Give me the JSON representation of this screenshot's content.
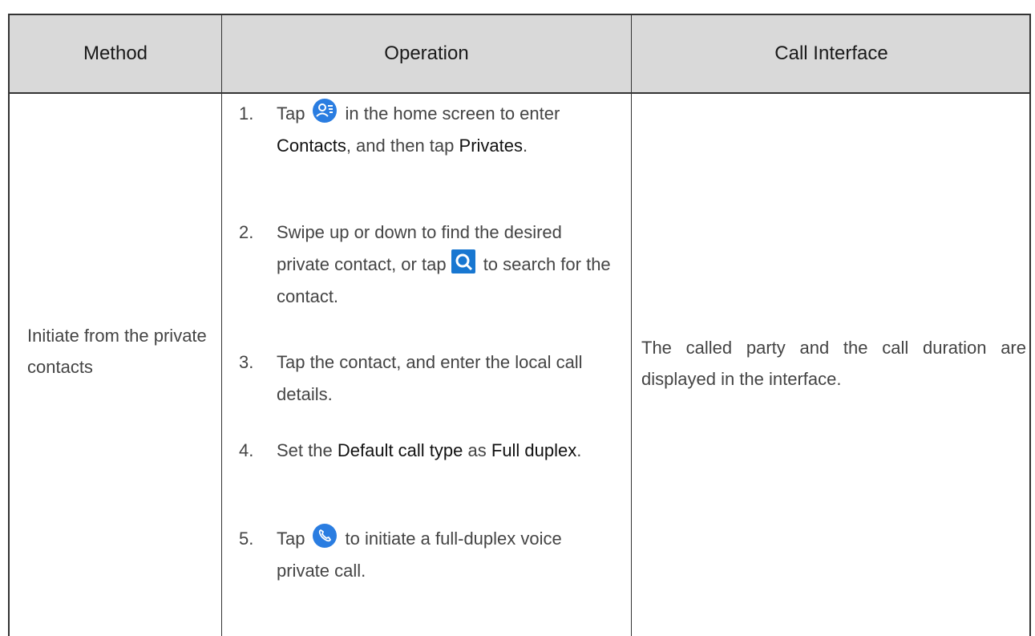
{
  "header": {
    "method": "Method",
    "operation": "Operation",
    "call_interface": "Call Interface"
  },
  "row": {
    "method": "Initiate from the private contacts",
    "call_interface": "The called party and the call duration are displayed in the interface.",
    "steps": [
      {
        "num": "1.",
        "a": "Tap",
        "b": "in the home screen to enter",
        "c": "Contacts",
        "d": ", and then tap",
        "e": "Privates",
        "f": "."
      },
      {
        "num": "2.",
        "a": "Swipe up or down to find the desired private contact, or tap",
        "b": "to search for the contact."
      },
      {
        "num": "3.",
        "a": "Tap the contact, and enter the local call details."
      },
      {
        "num": "4.",
        "a": "Set the",
        "b": "Default call type",
        "c": "as",
        "d": "Full duplex",
        "e": "."
      },
      {
        "num": "5.",
        "a": "Tap",
        "b": "to initiate a full-duplex voice private call."
      }
    ]
  },
  "icons": {
    "contacts": "contacts-icon",
    "search": "search-icon",
    "phone": "phone-icon"
  },
  "colors": {
    "header_bg": "#d9d9d9",
    "icon_blue": "#2a7de1",
    "search_blue": "#1877d1"
  }
}
